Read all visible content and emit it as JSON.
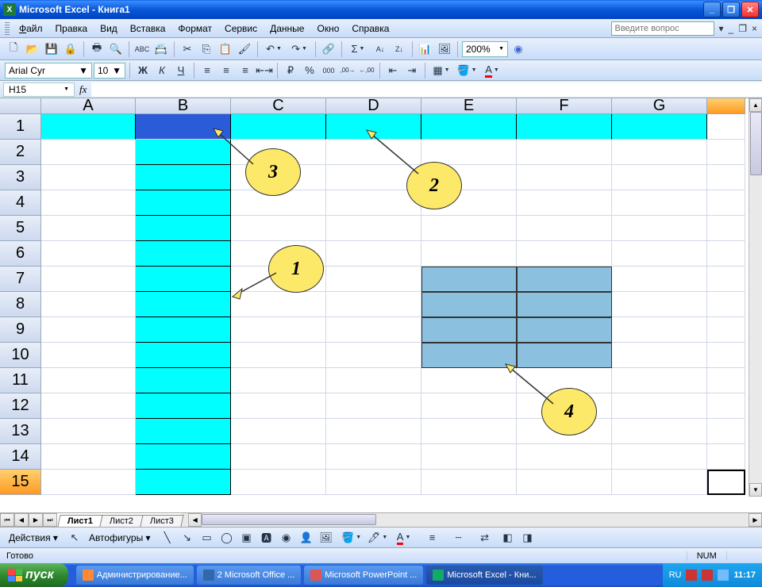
{
  "titlebar": {
    "app": "Microsoft Excel",
    "doc": "Книга1"
  },
  "menu": {
    "file": "Файл",
    "edit": "Правка",
    "view": "Вид",
    "insert": "Вставка",
    "format": "Формат",
    "tools": "Сервис",
    "data": "Данные",
    "window": "Окно",
    "help": "Справка",
    "question_placeholder": "Введите вопрос"
  },
  "toolbar": {
    "zoom": "200%"
  },
  "format": {
    "font": "Arial Cyr",
    "size": "10"
  },
  "namebox": "H15",
  "columns": [
    "A",
    "B",
    "C",
    "D",
    "E",
    "F",
    "G"
  ],
  "rows": [
    "1",
    "2",
    "3",
    "4",
    "5",
    "6",
    "7",
    "8",
    "9",
    "10",
    "11",
    "12",
    "13",
    "14",
    "15"
  ],
  "sheets": {
    "s1": "Лист1",
    "s2": "Лист2",
    "s3": "Лист3"
  },
  "drawbar": {
    "actions": "Действия",
    "autoshapes": "Автофигуры"
  },
  "status": {
    "ready": "Готово",
    "num": "NUM"
  },
  "callouts": {
    "c1": "1",
    "c2": "2",
    "c3": "3",
    "c4": "4"
  },
  "taskbar": {
    "start": "пуск",
    "t1": "Администрирование...",
    "t2": "2 Microsoft Office ...",
    "t3": "Microsoft PowerPoint ...",
    "t4": "Microsoft Excel - Кни...",
    "lang": "RU",
    "time": "11:17"
  }
}
